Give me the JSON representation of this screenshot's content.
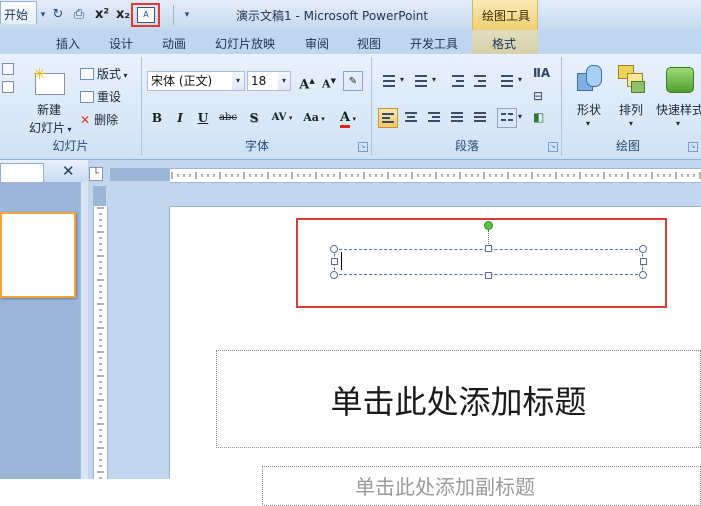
{
  "window": {
    "title": "演示文稿1 - Microsoft PowerPoint",
    "context_tab_group": "绘图工具"
  },
  "qat": {
    "icons": [
      "save-icon",
      "undo-icon",
      "redo-icon",
      "print-preview-icon",
      "superscript-icon",
      "subscript-icon",
      "text-box-icon",
      "customize-qat-icon"
    ]
  },
  "tabs": [
    {
      "label": "开始"
    },
    {
      "label": "插入"
    },
    {
      "label": "设计"
    },
    {
      "label": "动画"
    },
    {
      "label": "幻灯片放映"
    },
    {
      "label": "审阅"
    },
    {
      "label": "视图"
    },
    {
      "label": "开发工具"
    },
    {
      "label": "格式"
    }
  ],
  "ribbon": {
    "slides": {
      "label": "幻灯片",
      "new_slide": "新建",
      "new_slide_2": "幻灯片",
      "layout": "版式",
      "reset": "重设",
      "delete": "删除"
    },
    "font": {
      "label": "字体",
      "font_name": "宋体 (正文)",
      "font_size": "18",
      "buttons": {
        "bold": "B",
        "italic": "I",
        "underline": "U",
        "strike": "abc",
        "shadow": "S",
        "spacing": "AV",
        "case": "Aa",
        "color": "A",
        "grow": "A",
        "shrink": "A"
      }
    },
    "paragraph": {
      "label": "段落"
    },
    "drawing": {
      "label": "绘图",
      "shapes": "形状",
      "arrange": "排列",
      "quick_styles": "快速样式"
    }
  },
  "slide": {
    "title_placeholder": "单击此处添加标题",
    "subtitle_placeholder": "单击此处添加副标题"
  },
  "colors": {
    "highlight": "#e03a36",
    "ribbon": "#dbe8f7",
    "context_tab": "#efcf73"
  }
}
